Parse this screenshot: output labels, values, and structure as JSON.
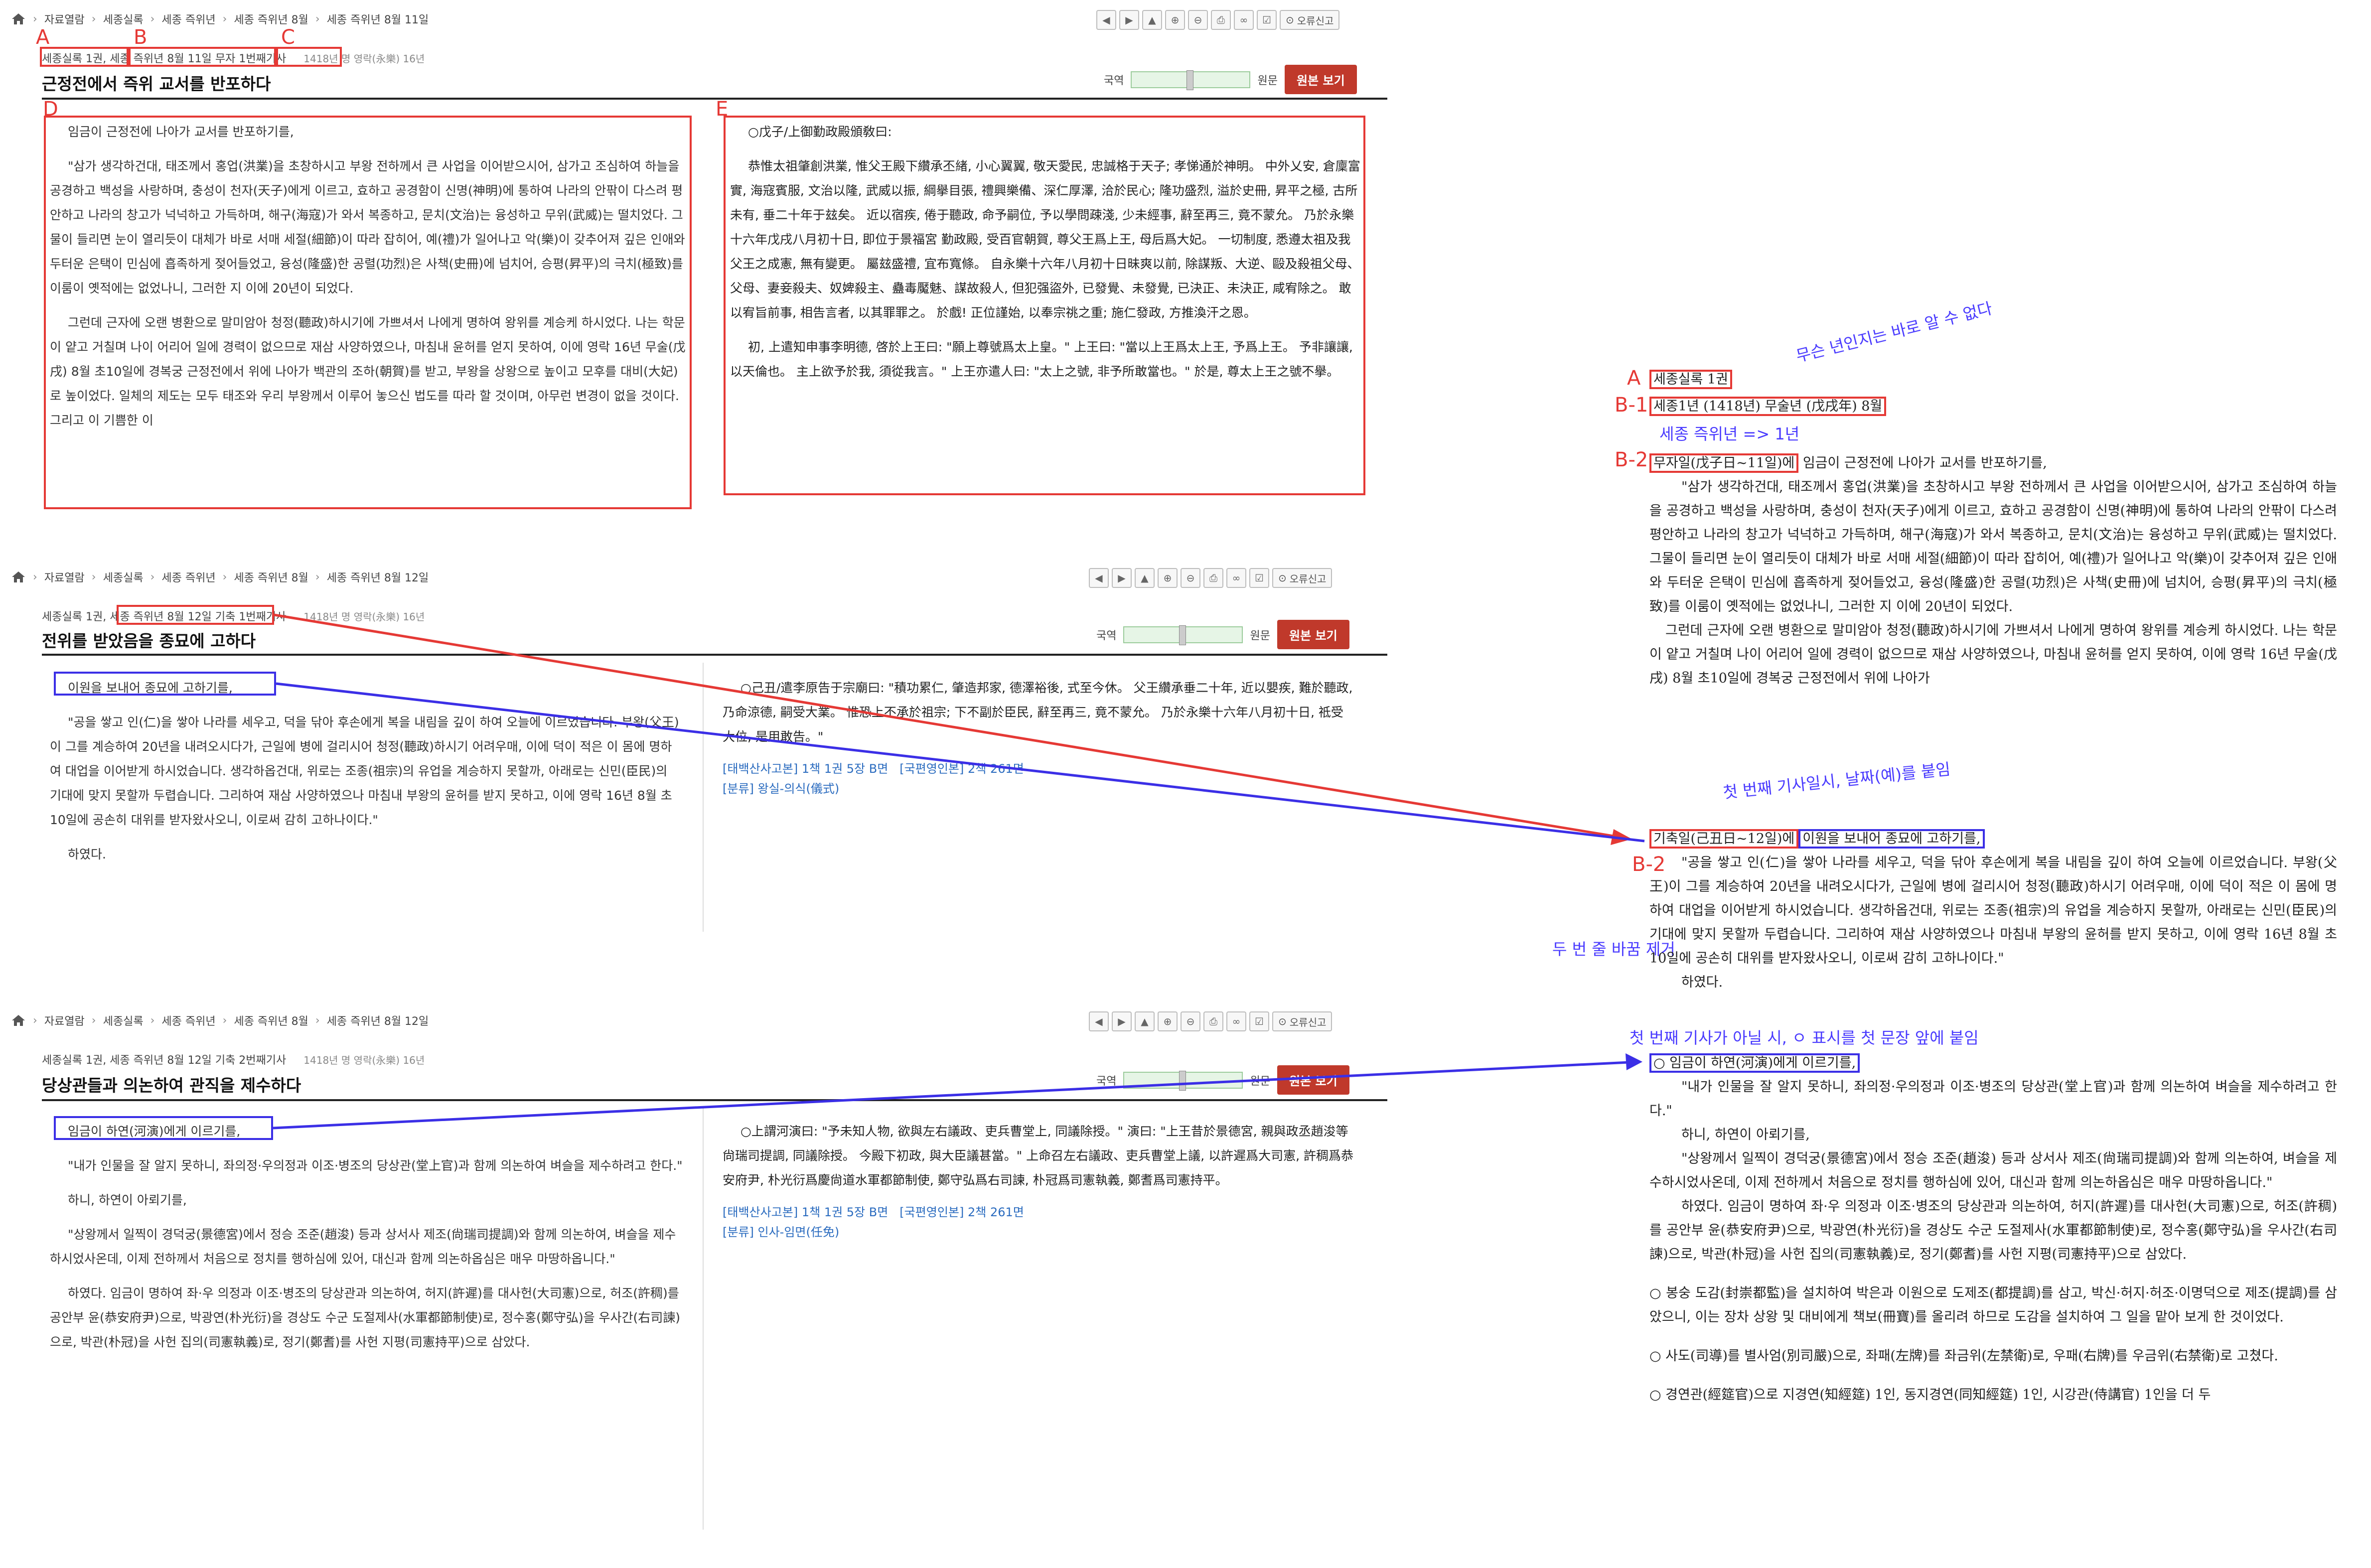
{
  "toolbar": {
    "icons": [
      "arrow-left-icon",
      "arrow-right-icon",
      "arrow-up-icon",
      "zoom-in-icon",
      "zoom-out-icon",
      "print-icon",
      "link-icon",
      "checkbox-icon"
    ],
    "report_label": "오류신고"
  },
  "compare": {
    "left_label": "국역",
    "right_label": "원문",
    "original_button": "원본 보기"
  },
  "panel1": {
    "breadcrumb": [
      "자료열람",
      "세종실록",
      "세종 즉위년",
      "세종 즉위년 8월",
      "세종 즉위년 8월 11일"
    ],
    "meta_a": "세종실록 1권",
    "meta_b": "세종 즉위년 8월 11일 무자",
    "meta_c": "1번째기사",
    "year": "1418년 명 영락(永樂) 16년",
    "title": "근정전에서 즉위 교서를 반포하다",
    "kor": [
      "임금이 근정전에 나아가 교서를 반포하기를,",
      "\"삼가 생각하건대, 태조께서 홍업(洪業)을 초창하시고 부왕 전하께서 큰 사업을 이어받으시어, 삼가고 조심하여 하늘을 공경하고 백성을 사랑하며, 충성이 천자(天子)에게 이르고, 효하고 공경함이 신명(神明)에 통하여 나라의 안팎이 다스려 평안하고 나라의 창고가 넉넉하고 가득하며, 해구(海寇)가 와서 복종하고, 문치(文治)는 융성하고 무위(武威)는 떨치었다. 그물이 들리면 눈이 열리듯이 대체가 바로 서매 세절(細節)이 따라 잡히어, 예(禮)가 일어나고 악(樂)이 갖추어져 깊은 인애와 두터운 은택이 민심에 흡족하게 젖어들었고, 융성(隆盛)한 공렬(功烈)은 사책(史冊)에 넘치어, 승평(昇平)의 극치(極致)를 이룸이 옛적에는 없었나니, 그러한 지 이에 20년이 되었다.",
      "그런데 근자에 오랜 병환으로 말미암아 청정(聽政)하시기에 가쁘셔서 나에게 명하여 왕위를 계승케 하시었다. 나는 학문이 얕고 거칠며 나이 어리어 일에 경력이 없으므로 재삼 사양하였으나, 마침내 윤허를 얻지 못하여, 이에 영락 16년 무술(戊戌) 8월 초10일에 경복궁 근정전에서 위에 나아가 백관의 조하(朝賀)를 받고, 부왕을 상왕으로 높이고 모후를 대비(大妃)로 높이었다. 일체의 제도는 모두 태조와 우리 부왕께서 이루어 놓으신 법도를 따라 할 것이며, 아무런 변경이 없을 것이다. 그리고 이 기쁨한 이"
    ],
    "chi": [
      "○戊子/上御勤政殿頒敎曰:",
      "恭惟太祖肇創洪業, 惟父王殿下纘承丕緖, 小心翼翼, 敬天愛民, 忠誠格于天子; 孝悌通於神明。 中外乂安, 倉廩富實, 海寇賓服, 文治以隆, 武威以振, 綱擧目張, 禮興樂備、深仁厚澤, 洽於民心; 隆功盛烈, 溢於史冊, 昇平之極, 古所未有, 垂二十年于玆矣。 近以宿疾, 倦于聽政, 命予嗣位, 予以學問疎淺, 少未經事, 辭至再三, 竟不蒙允。 乃於永樂十六年戊戌八月初十日, 即位于景福宮 勤政殿, 受百官朝賀, 尊父王爲上王, 母后爲大妃。 一切制度, 悉遵太祖及我父王之成憲, 無有變更。 屬玆盛禮, 宜布寬條。 自永樂十六年八月初十日昧爽以前, 除謀叛、大逆、毆及殺祖父母、父母、妻妾殺夫、奴婢殺主、蠱毒魘魅、謀故殺人, 但犯强盜外, 已發覺、未發覺, 已決正、未決正, 咸宥除之。 敢以宥旨前事, 相告言者, 以其罪罪之。 於戲! 正位謹始, 以奉宗祧之重; 施仁發政, 方推渙汗之恩。",
      "初, 上遣知申事李明德, 啓於上王曰: \"願上尊號爲太上皇。\" 上王曰: \"當以上王爲太上王, 予爲上王。 予非讓讓, 以天倫也。 主上欲予於我, 須從我言。\" 上王亦遣人曰: \"太上之號, 非予所敢當也。\" 於是, 尊太上王之號不擧。"
    ]
  },
  "panel2": {
    "breadcrumb": [
      "자료열람",
      "세종실록",
      "세종 즉위년",
      "세종 즉위년 8월",
      "세종 즉위년 8월 12일"
    ],
    "meta_a": "세종실록 1권,",
    "meta_b": "세종 즉위년 8월 12일 기축",
    "meta_c": "1번째기사",
    "year": "1418년 명 영락(永樂) 16년",
    "title": "전위를 받았음을 종묘에 고하다",
    "kor": [
      "이원을 보내어 종묘에 고하기를,",
      "\"공을 쌓고 인(仁)을 쌓아 나라를 세우고, 덕을 닦아 후손에게 복을 내림을 깊이 하여 오늘에 이르었습니다. 부왕(父王)이 그를 계승하여 20년을 내려오시다가, 근일에 병에 걸리시어 청정(聽政)하시기 어려우매, 이에 덕이 적은 이 몸에 명하여 대업을 이어받게 하시었습니다. 생각하옵건대, 위로는 조종(祖宗)의 유업을 계승하지 못할까, 아래로는 신민(臣民)의 기대에 맞지 못할까 두렵습니다. 그리하여 재삼 사양하였으나 마침내 부왕의 윤허를 받지 못하고, 이에 영락 16년 8월 초10일에 공손히 대위를 받자왔사오니, 이로써 감히 고하나이다.\"",
      "하였다."
    ],
    "chi": [
      "○己丑/遣李原告于宗廟曰: \"積功累仁, 肇造邦家, 德澤裕後, 式至今休。 父王纘承垂二十年, 近以嬰疾, 難於聽政, 乃命涼德, 嗣受大業。 惟恐上不承於祖宗; 下不副於臣民, 辭至再三, 竟不蒙允。 乃於永樂十六年八月初十日, 祗受大位, 是用敢告。\""
    ],
    "ref1": "[태백산사고본] 1책 1권 5장 B면",
    "ref2": "[국편영인본] 2책 261면",
    "cat": "[분류] 왕실-의식(儀式)"
  },
  "panel3": {
    "breadcrumb": [
      "자료열람",
      "세종실록",
      "세종 즉위년",
      "세종 즉위년 8월",
      "세종 즉위년 8월 12일"
    ],
    "meta": "세종실록 1권, 세종 즉위년 8월 12일 기축 2번째기사",
    "year": "1418년 명 영락(永樂) 16년",
    "title": "당상관들과 의논하여 관직을 제수하다",
    "kor": [
      "임금이 하연(河演)에게 이르기를,",
      "\"내가 인물을 잘 알지 못하니, 좌의정·우의정과 이조·병조의 당상관(堂上官)과 함께 의논하여 벼슬을 제수하려고 한다.\"",
      "하니, 하연이 아뢰기를,",
      "\"상왕께서 일찍이 경덕궁(景德宮)에서 정승 조준(趙浚) 등과 상서사 제조(尙瑞司提調)와 함께 의논하여, 벼슬을 제수하시었사온데, 이제 전하께서 처음으로 정치를 행하심에 있어, 대신과 함께 의논하옵심은 매우 마땅하옵니다.\"",
      "하였다. 임금이 명하여 좌·우 의정과 이조·병조의 당상관과 의논하여, 허지(許遲)를 대사헌(大司憲)으로, 허조(許稠)를 공안부 윤(恭安府尹)으로, 박광연(朴光衍)을 경상도 수군 도절제사(水軍都節制使)로, 정수홍(鄭守弘)을 우사간(右司諫)으로, 박관(朴冠)을 사헌 집의(司憲執義)로, 정기(鄭耆)를 사헌 지평(司憲持平)으로 삼았다."
    ],
    "chi": [
      "○上謂河演曰: \"予未知人物, 欲與左右議政、吏兵曹堂上, 同議除授。\" 演曰: \"上王昔於景德宮, 親與政丞趙浚等尙瑞司提調, 同議除授。 今殿下初政, 與大臣議甚當。\" 上命召左右議政、吏兵曹堂上議, 以許遲爲大司憲, 許稠爲恭安府尹, 朴光衍爲慶尙道水軍都節制使, 鄭守弘爲右司諫, 朴冠爲司憲執義, 鄭耆爲司憲持平。"
    ],
    "ref1": "[태백산사고본] 1책 1권 5장 B면",
    "ref2": "[국편영인본] 2책 261면",
    "cat": "[분류] 인사-임면(任免)"
  },
  "labels": {
    "A": "A",
    "B": "B",
    "C": "C",
    "D": "D",
    "E": "E",
    "A2": "A",
    "B1": "B-1",
    "B2": "B-2",
    "B2b": "B-2",
    "note_year": "무슨 년인지는 바로 알 수 없다",
    "note_conv": "세종 즉위년 => 1년",
    "note_first": "첫 번째 기사일시, 날짜(예)를 붙임",
    "note_linebreak": "두 번 줄 바꿈 제거",
    "note_circle": "첫 번째 기사가 아닐 시, ㅇ 표시를 첫 문장 앞에 붙임"
  },
  "doc": {
    "a": "세종실록 1권",
    "b1": "세종1년 (1418년) 무술년 (戊戌年) 8월",
    "b2": "무자일(戊子日~11일)에",
    "b2_rest": " 임금이 근정전에 나아가 교서를 반포하기를,",
    "p1": "\"삼가 생각하건대, 태조께서 홍업(洪業)을 초창하시고 부왕 전하께서 큰 사업을 이어받으시어, 삼가고 조심하여 하늘을 공경하고 백성을 사랑하며, 충성이 천자(天子)에게 이르고, 효하고 공경함이 신명(神明)에 통하여 나라의 안팎이 다스려 평안하고 나라의 창고가 넉넉하고 가득하며, 해구(海寇)가 와서 복종하고, 문치(文治)는 융성하고 무위(武威)는 떨치었다. 그물이 들리면 눈이 열리듯이 대체가 바로 서매 세절(細節)이 따라 잡히어, 예(禮)가 일어나고 악(樂)이 갖추어져 깊은 인애와 두터운 은택이 민심에 흡족하게 젖어들었고, 융성(隆盛)한 공렬(功烈)은 사책(史冊)에 넘치어, 승평(昇平)의 극치(極致)를 이룸이 옛적에는 없었나니, 그러한 지 이에 20년이 되었다.",
    "p2": "그런데 근자에 오랜 병환으로 말미암아 청정(聽政)하시기에 가쁘셔서 나에게 명하여 왕위를 계승케 하시었다. 나는 학문이 얕고 거칠며 나이 어리어 일에 경력이 없으므로 재삼 사양하였으나, 마침내 윤허를 얻지 못하여, 이에 영락 16년 무술(戊戌) 8월 초10일에 경복궁 근정전에서 위에 나아가",
    "c1": "기축일(己丑日~12일)에",
    "c1_rest": "이원을 보내어 종묘에 고하기를,",
    "c2": "\"공을 쌓고 인(仁)을 쌓아 나라를 세우고, 덕을 닦아 후손에게 복을 내림을 깊이 하여 오늘에 이르었습니다. 부왕(父王)이 그를 계승하여 20년을 내려오시다가, 근일에 병에 걸리시어 청정(聽政)하시기 어려우매, 이에 덕이 적은 이 몸에 명하여 대업을 이어받게 하시었습니다. 생각하옵건대, 위로는 조종(祖宗)의 유업을 계승하지 못할까, 아래로는 신민(臣民)의 기대에 맞지 못할까 두렵습니다. 그리하여 재삼 사양하였으나 마침내 부왕의 윤허를 받지 못하고, 이에 영락 16년 8월 초10일에 공손히 대위를 받자왔사오니, 이로써 감히 고하나이다.\"",
    "c3": "하였다.",
    "d1": "○ 임금이 하연(河演)에게 이르기를,",
    "d2": "\"내가 인물을 잘 알지 못하니, 좌의정·우의정과 이조·병조의 당상관(堂上官)과 함께 의논하여 벼슬을 제수하려고 한다.\"",
    "d3": "하니, 하연이 아뢰기를,",
    "d4": "\"상왕께서 일찍이 경덕궁(景德宮)에서 정승 조준(趙浚) 등과 상서사 제조(尙瑞司提調)와 함께 의논하여, 벼슬을 제수하시었사온데, 이제 전하께서 처음으로 정치를 행하심에 있어, 대신과 함께 의논하옵심은 매우 마땅하옵니다.\"",
    "d5": "하였다. 임금이 명하여 좌·우 의정과 이조·병조의 당상관과 의논하여, 허지(許遲)를 대사헌(大司憲)으로, 허조(許稠)를 공안부 윤(恭安府尹)으로, 박광연(朴光衍)을 경상도 수군 도절제사(水軍都節制使)로, 정수홍(鄭守弘)을 우사간(右司諫)으로, 박관(朴冠)을 사헌 집의(司憲執義)로, 정기(鄭耆)를 사헌 지평(司憲持平)으로 삼았다.",
    "e1": "○ 봉숭 도감(封崇都監)을 설치하여 박은과 이원으로 도제조(都提調)를 삼고, 박신·허지·허조·이명덕으로 제조(提調)를 삼았으니, 이는 장차 상왕 및 대비에게 책보(冊寶)를 올리려 하므로 도감을 설치하여 그 일을 맡아 보게 한 것이었다.",
    "e2": "○ 사도(司導)를 별사엄(別司嚴)으로, 좌패(左牌)를 좌금위(左禁衛)로, 우패(右牌)를 우금위(右禁衛)로 고쳤다.",
    "e3": "○ 경연관(經筵官)으로 지경연(知經筵) 1인, 동지경연(同知經筵) 1인, 시강관(侍講官) 1인을 더 두"
  }
}
